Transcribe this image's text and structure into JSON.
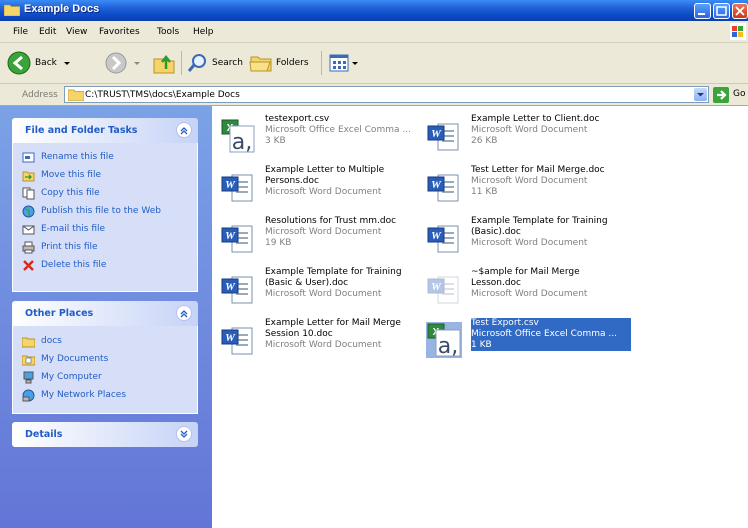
{
  "window": {
    "title": "Example Docs"
  },
  "menu": [
    "File",
    "Edit",
    "View",
    "Favorites",
    "Tools",
    "Help"
  ],
  "toolbar": {
    "back": "Back",
    "search": "Search",
    "folders": "Folders"
  },
  "address": {
    "label": "Address",
    "path": "C:\\TRUST\\TMS\\docs\\Example Docs",
    "go": "Go"
  },
  "tasks_panel": {
    "title": "File and Folder Tasks",
    "items": [
      "Rename this file",
      "Move this file",
      "Copy this file",
      "Publish this file to the Web",
      "E-mail this file",
      "Print this file",
      "Delete this file"
    ]
  },
  "places_panel": {
    "title": "Other Places",
    "items": [
      "docs",
      "My Documents",
      "My Computer",
      "My Network Places"
    ]
  },
  "details_panel": {
    "title": "Details"
  },
  "files": [
    {
      "name": "testexport.csv",
      "desc": "Microsoft Office Excel Comma ...",
      "size": "3 KB",
      "type": "csv"
    },
    {
      "name": "Example Letter to Client.doc",
      "desc": "Microsoft Word Document",
      "size": "26 KB",
      "type": "doc"
    },
    {
      "name": "Example Letter to Multiple Persons.doc",
      "desc": "Microsoft Word Document",
      "size": "",
      "type": "doc"
    },
    {
      "name": "Test Letter for Mail Merge.doc",
      "desc": "Microsoft Word Document",
      "size": "11 KB",
      "type": "doc"
    },
    {
      "name": "Resolutions for Trust mm.doc",
      "desc": "Microsoft Word Document",
      "size": "19 KB",
      "type": "doc"
    },
    {
      "name": "Example Template for Training (Basic).doc",
      "desc": "Microsoft Word Document",
      "size": "",
      "type": "doc"
    },
    {
      "name": "Example Template for Training (Basic & User).doc",
      "desc": "Microsoft Word Document",
      "size": "",
      "type": "doc"
    },
    {
      "name": "~$ample for Mail Merge Lesson.doc",
      "desc": "Microsoft Word Document",
      "size": "",
      "type": "doc-ghost"
    },
    {
      "name": "Example Letter for Mail Merge Session 10.doc",
      "desc": "Microsoft Word Document",
      "size": "",
      "type": "doc"
    },
    {
      "name": "Test Export.csv",
      "desc": "Microsoft Office Excel Comma ...",
      "size": "1 KB",
      "type": "csv",
      "selected": true
    }
  ]
}
